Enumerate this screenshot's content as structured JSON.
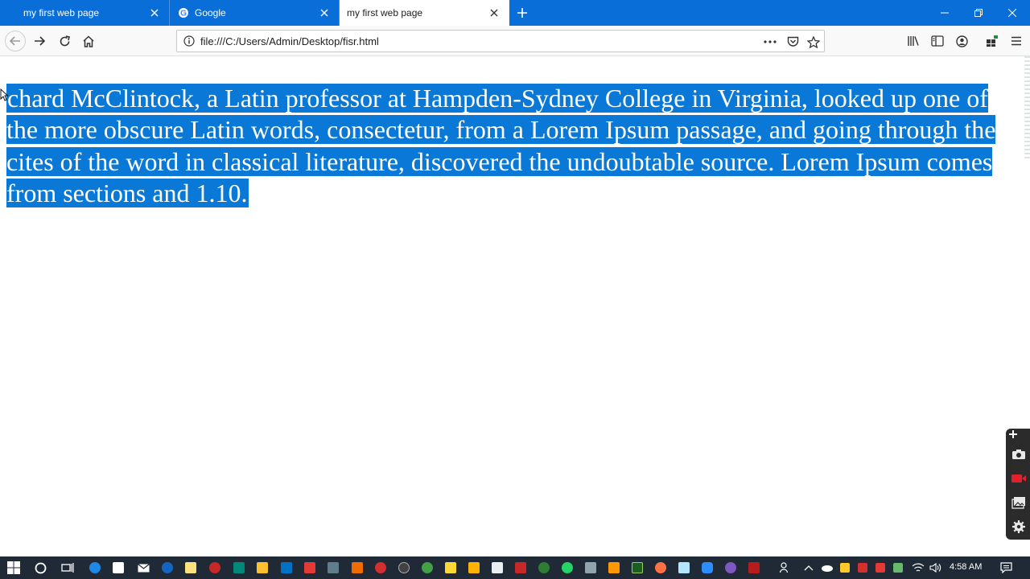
{
  "tabs": [
    {
      "title": "my first web page",
      "icon": "page-icon",
      "active": false
    },
    {
      "title": "Google",
      "icon": "google-icon",
      "active": false
    },
    {
      "title": "my first web page",
      "icon": "page-icon",
      "active": true
    }
  ],
  "navbar": {
    "url": "file:///C:/Users/Admin/Desktop/fisr.html"
  },
  "content": {
    "paragraph": "chard McClintock, a Latin professor at Hampden-Sydney College in Virginia, looked up one of the more obscure Latin words, consectetur, from a Lorem Ipsum passage, and going through the cites of the word in classical literature, discovered the undoubtable source. Lorem Ipsum comes from sections and 1.10."
  },
  "taskbar": {
    "time": "4:58 AM"
  },
  "colors": {
    "accent": "#0a6ed9",
    "selection": "#0a78d7",
    "taskbar": "#1f2a36"
  }
}
